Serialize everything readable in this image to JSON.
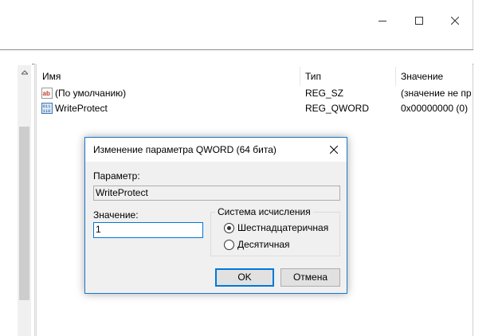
{
  "window": {
    "controls": [
      "minimize",
      "maximize",
      "close"
    ]
  },
  "listview": {
    "columns": [
      "Имя",
      "Тип",
      "Значение"
    ],
    "rows": [
      {
        "icon": "string-value-icon",
        "name": "(По умолчанию)",
        "type": "REG_SZ",
        "value": "(значение не пр"
      },
      {
        "icon": "binary-value-icon",
        "name": "WriteProtect",
        "type": "REG_QWORD",
        "value": "0x00000000 (0)"
      }
    ]
  },
  "dialog": {
    "title": "Изменение параметра QWORD (64 бита)",
    "param_label": "Параметр:",
    "param_value": "WriteProtect",
    "value_label": "Значение:",
    "value_input": "1",
    "base_group_label": "Система исчисления",
    "base_options": [
      {
        "label": "Шестнадцатеричная",
        "selected": true
      },
      {
        "label": "Десятичная",
        "selected": false
      }
    ],
    "ok_label": "OK",
    "cancel_label": "Отмена"
  },
  "colors": {
    "accent": "#0078d7",
    "dialog_border": "#1979ca",
    "dialog_bg": "#f0f0f0"
  }
}
